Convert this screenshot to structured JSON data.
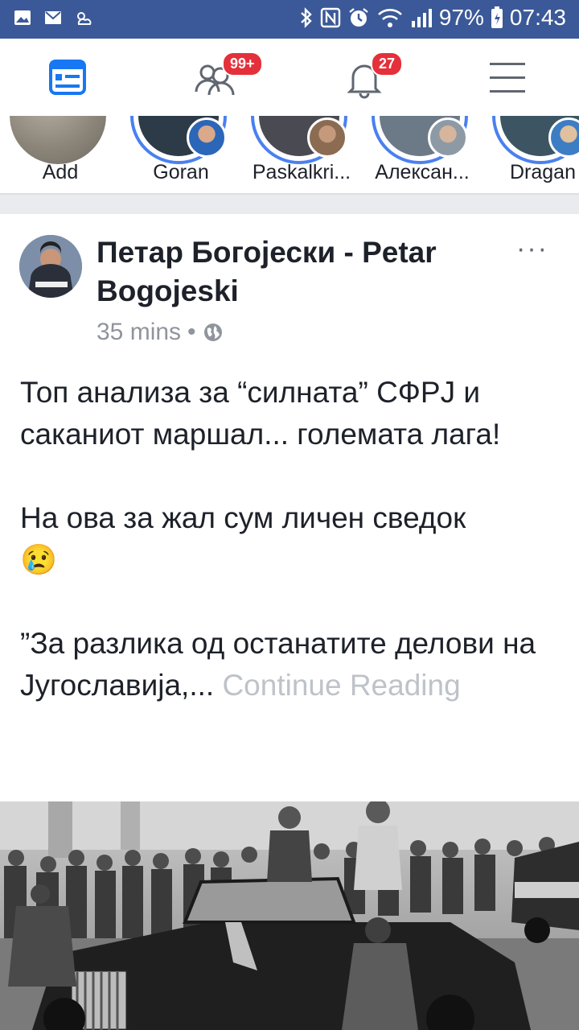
{
  "status_bar": {
    "battery": "97%",
    "time": "07:43"
  },
  "nav": {
    "friends_badge": "99+",
    "notifications_badge": "27"
  },
  "stories": [
    {
      "name": "Add"
    },
    {
      "name": "Goran"
    },
    {
      "name": "Paskalkri..."
    },
    {
      "name": "Алексан..."
    },
    {
      "name": "Dragan"
    }
  ],
  "post": {
    "author": "Петар Богојески - Petar Bogojeski",
    "time": "35 mins",
    "separator": "•",
    "text_line1": "Топ анализа за “силната” СФРЈ и саканиот маршал... големата лага!",
    "text_line2": "На ова за жал сум личен сведок",
    "text_line3": "”За разлика од останатите делови на Југославија,...",
    "continue_label": "Continue Reading",
    "emoji": "😢",
    "more": "···"
  },
  "colors": {
    "status_bar": "#3b5998",
    "active_icon": "#1877f2",
    "badge": "#e4303a"
  }
}
